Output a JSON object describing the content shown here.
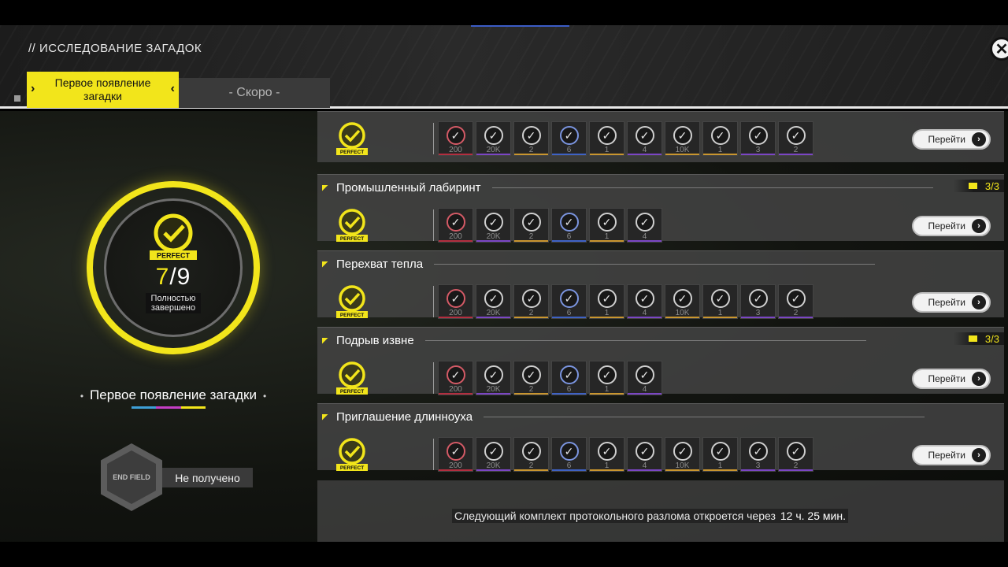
{
  "header": {
    "section_title": "// ИССЛЕДОВАНИЕ ЗАГАДОК",
    "tabs": [
      {
        "label": "Первое появление загадки",
        "active": true
      },
      {
        "label": "- Скоро -",
        "active": false
      }
    ],
    "close_icon": "close-icon"
  },
  "left_panel": {
    "badge_label": "PERFECT",
    "progress_current": "7",
    "progress_total": "/9",
    "progress_label": "Полностью завершено",
    "title": "Первое появление загадки",
    "strip_colors": [
      "#3e9fd6",
      "#c43ec4",
      "#f2e51b"
    ],
    "reward_emblem": "END FIELD",
    "reward_status": "Не получено"
  },
  "rows": [
    {
      "name": "",
      "count": "",
      "badge": "PERFECT",
      "button": "Перейти",
      "tiles": [
        {
          "amount": "200",
          "color": "red"
        },
        {
          "amount": "20K",
          "color": "purple"
        },
        {
          "amount": "2",
          "color": "gold"
        },
        {
          "amount": "6",
          "color": "blue"
        },
        {
          "amount": "1",
          "color": "gold"
        },
        {
          "amount": "4",
          "color": "purple"
        },
        {
          "amount": "10K",
          "color": "gold"
        },
        {
          "amount": "1",
          "color": "gold"
        },
        {
          "amount": "3",
          "color": "purple"
        },
        {
          "amount": "2",
          "color": "purple"
        }
      ]
    },
    {
      "name": "Промышленный лабиринт",
      "count": "3/3",
      "badge": "PERFECT",
      "button": "Перейти",
      "tiles": [
        {
          "amount": "200",
          "color": "red"
        },
        {
          "amount": "20K",
          "color": "purple"
        },
        {
          "amount": "2",
          "color": "gold"
        },
        {
          "amount": "6",
          "color": "blue"
        },
        {
          "amount": "1",
          "color": "gold"
        },
        {
          "amount": "4",
          "color": "purple"
        }
      ]
    },
    {
      "name": "Перехват тепла",
      "count": "",
      "badge": "PERFECT",
      "button": "Перейти",
      "tiles": [
        {
          "amount": "200",
          "color": "red"
        },
        {
          "amount": "20K",
          "color": "purple"
        },
        {
          "amount": "2",
          "color": "gold"
        },
        {
          "amount": "6",
          "color": "blue"
        },
        {
          "amount": "1",
          "color": "gold"
        },
        {
          "amount": "4",
          "color": "purple"
        },
        {
          "amount": "10K",
          "color": "gold"
        },
        {
          "amount": "1",
          "color": "gold"
        },
        {
          "amount": "3",
          "color": "purple"
        },
        {
          "amount": "2",
          "color": "purple"
        }
      ]
    },
    {
      "name": "Подрыв извне",
      "count": "3/3",
      "badge": "PERFECT",
      "button": "Перейти",
      "tiles": [
        {
          "amount": "200",
          "color": "red"
        },
        {
          "amount": "20K",
          "color": "purple"
        },
        {
          "amount": "2",
          "color": "gold"
        },
        {
          "amount": "6",
          "color": "blue"
        },
        {
          "amount": "1",
          "color": "gold"
        },
        {
          "amount": "4",
          "color": "purple"
        }
      ]
    },
    {
      "name": "Приглашение длинноуха",
      "count": "",
      "badge": "PERFECT",
      "button": "Перейти",
      "tiles": [
        {
          "amount": "200",
          "color": "red"
        },
        {
          "amount": "20K",
          "color": "purple"
        },
        {
          "amount": "2",
          "color": "gold"
        },
        {
          "amount": "6",
          "color": "blue"
        },
        {
          "amount": "1",
          "color": "gold"
        },
        {
          "amount": "4",
          "color": "purple"
        },
        {
          "amount": "10K",
          "color": "gold"
        },
        {
          "amount": "1",
          "color": "gold"
        },
        {
          "amount": "3",
          "color": "purple"
        },
        {
          "amount": "2",
          "color": "purple"
        }
      ]
    }
  ],
  "footer": {
    "next_text": "Следующий комплект протокольного разлома откроется через",
    "next_time": "12 ч. 25 мин."
  },
  "colors": {
    "accent": "#f2e51b",
    "panel": "#464646"
  }
}
